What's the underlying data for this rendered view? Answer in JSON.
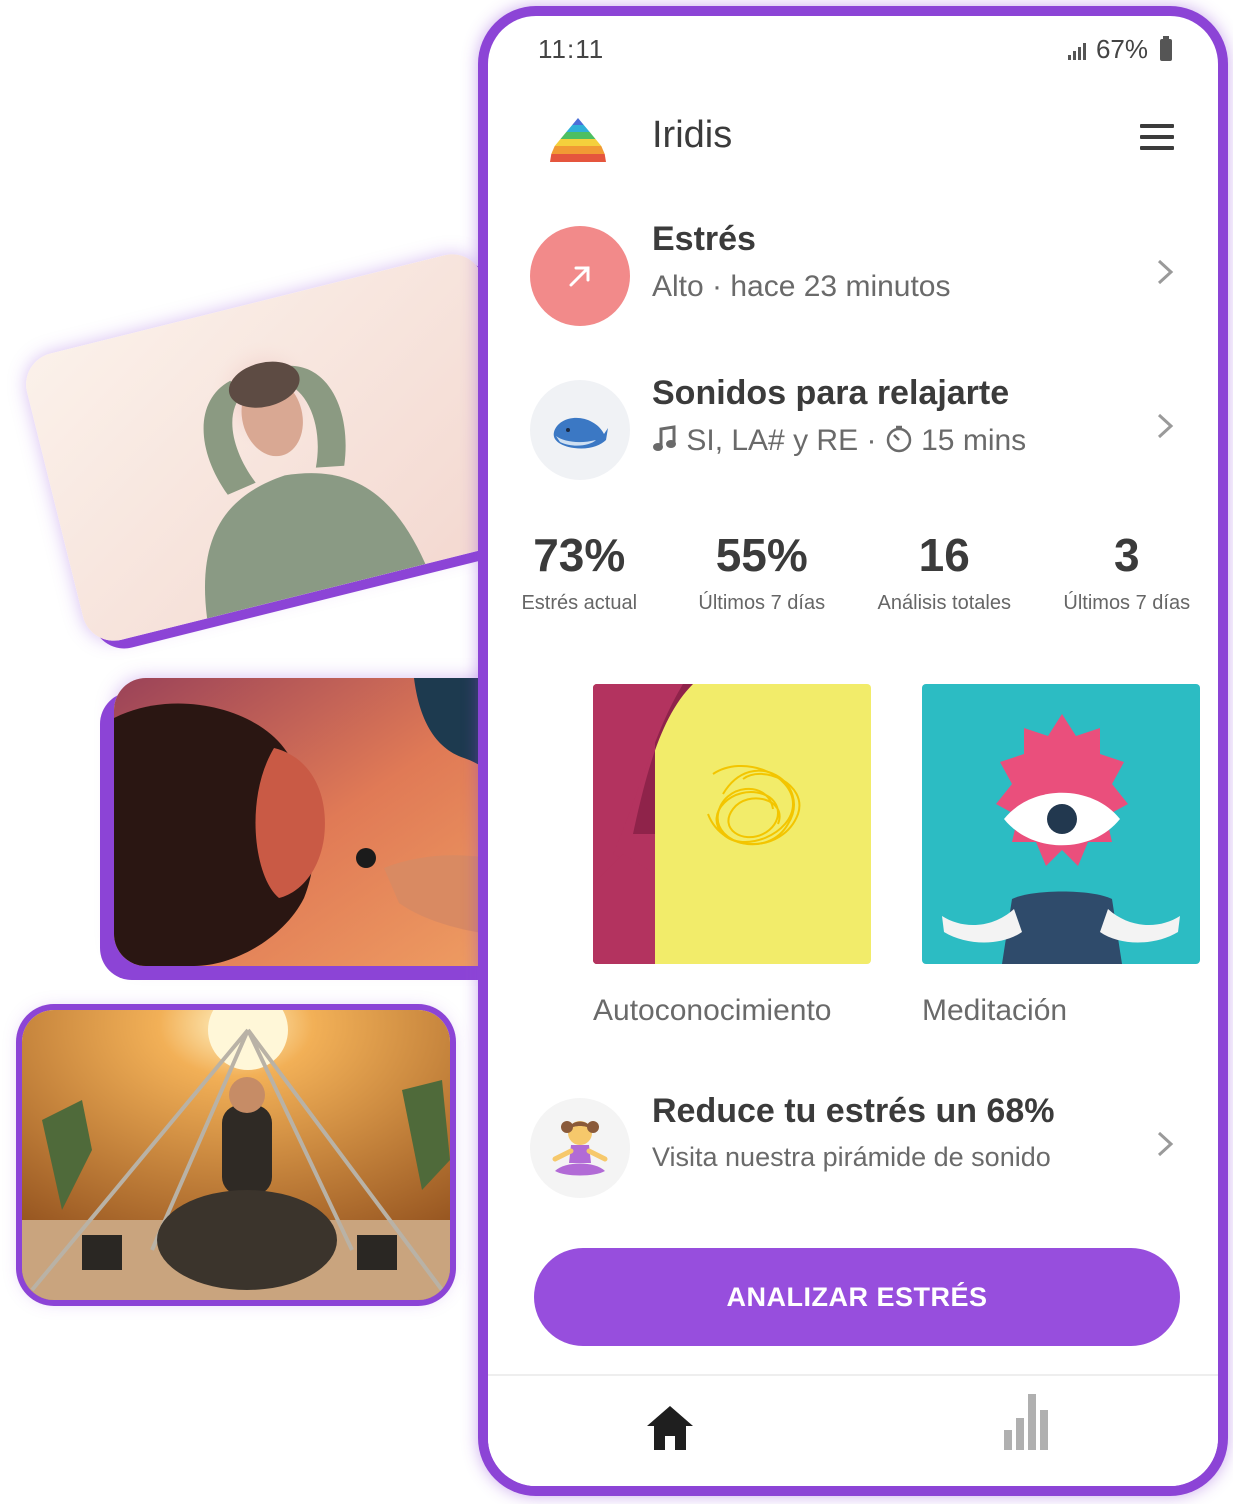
{
  "status_bar": {
    "time": "11:11",
    "battery": "67%"
  },
  "header": {
    "title": "Iridis"
  },
  "stress_row": {
    "title": "Estrés",
    "subtitle": "Alto · hace 23 minutos",
    "color": "#f28a8a"
  },
  "sounds_row": {
    "title": "Sonidos para relajarte",
    "notes": "SI, LA# y RE",
    "duration": "15 mins"
  },
  "stats": [
    {
      "value": "73%",
      "label": "Estrés actual"
    },
    {
      "value": "55%",
      "label": "Últimos 7 días"
    },
    {
      "value": "16",
      "label": "Análisis totales"
    },
    {
      "value": "3",
      "label": "Últimos 7 días"
    }
  ],
  "tiles": [
    {
      "label": "Autoconocimiento"
    },
    {
      "label": "Meditación"
    }
  ],
  "promo_row": {
    "title": "Reduce tu estrés un 68%",
    "subtitle": "Visita nuestra pirámide de sonido"
  },
  "cta": {
    "label": "ANALIZAR ESTRÉS",
    "color": "#974edd"
  },
  "brand_color": "#8c44d6",
  "nav": {
    "items": [
      "home-icon",
      "bar-chart-icon"
    ]
  }
}
